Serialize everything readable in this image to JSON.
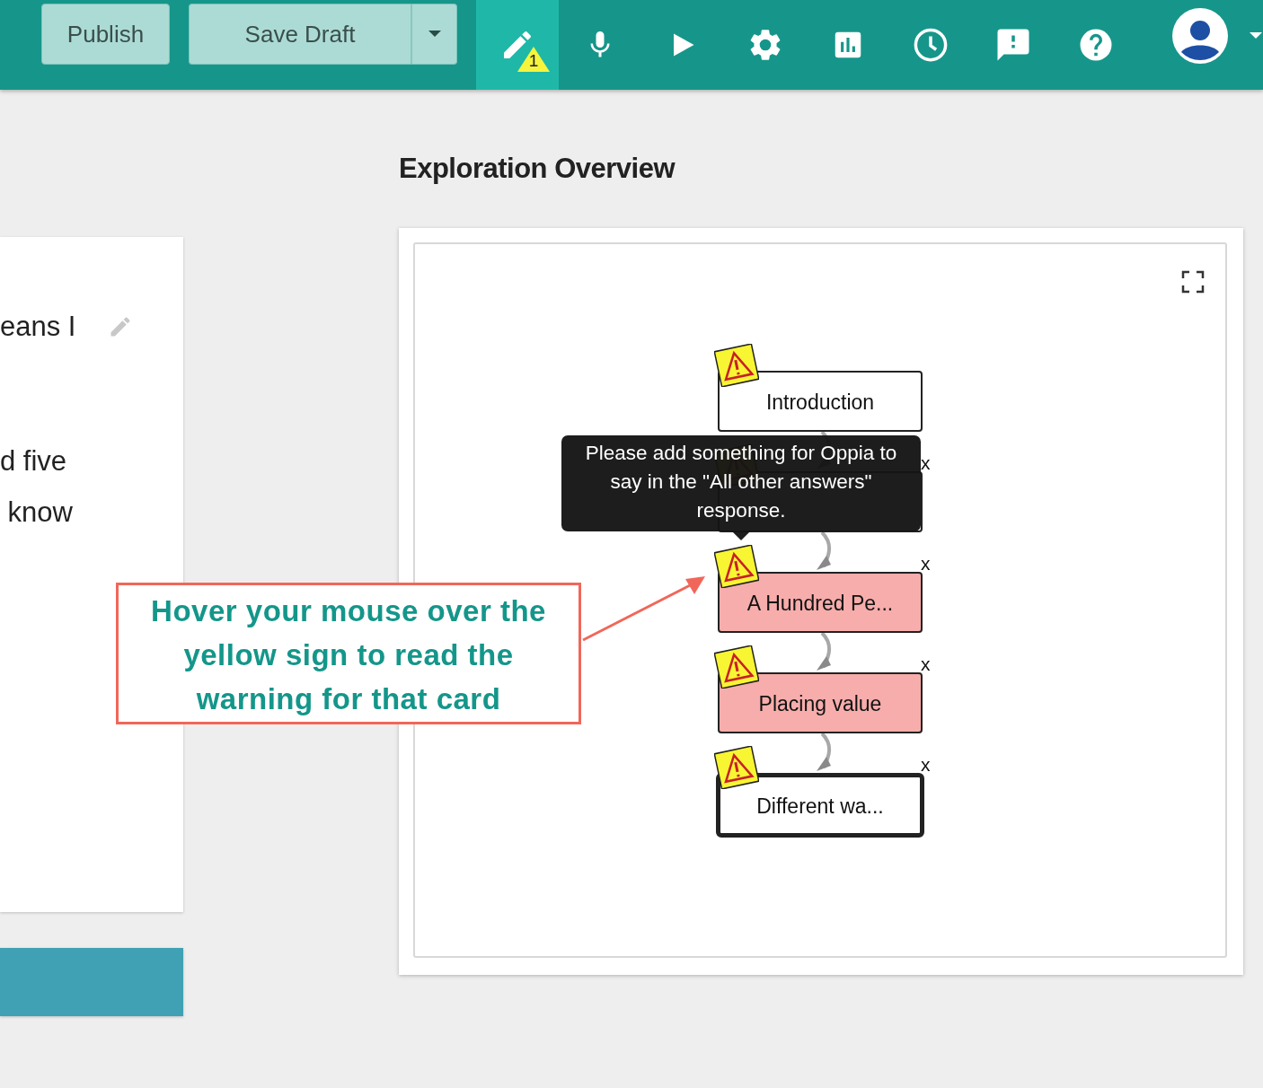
{
  "toolbar": {
    "publish": "Publish",
    "save_draft": "Save Draft",
    "tabs": [
      {
        "kind": "pencil",
        "selected": true,
        "warning_count": "1"
      },
      {
        "kind": "mic",
        "selected": false
      },
      {
        "kind": "play",
        "selected": false
      },
      {
        "kind": "gear",
        "selected": false
      },
      {
        "kind": "chart",
        "selected": false
      },
      {
        "kind": "clock",
        "selected": false
      },
      {
        "kind": "feedback",
        "selected": false
      },
      {
        "kind": "help",
        "selected": false
      }
    ]
  },
  "left_card": {
    "lines": [
      "eans I",
      "d five",
      " know"
    ]
  },
  "heading": "Exploration Overview",
  "graph": {
    "nodes": [
      {
        "label": "Introduction",
        "highlighted": false,
        "current": false
      },
      {
        "highlighted": false,
        "current": false,
        "delete_label": "x"
      },
      {
        "label": "A Hundred Pe...",
        "highlighted": true,
        "current": false,
        "delete_label": "x"
      },
      {
        "label": "Placing value",
        "highlighted": true,
        "current": false,
        "delete_label": "x"
      },
      {
        "label": "Different wa...",
        "highlighted": false,
        "current": true,
        "delete_label": "x"
      }
    ],
    "tooltip": "Please add something for Oppia to say in the \"All other answers\" response."
  },
  "callout": "Hover your mouse over the yellow sign to read the warning for that card"
}
